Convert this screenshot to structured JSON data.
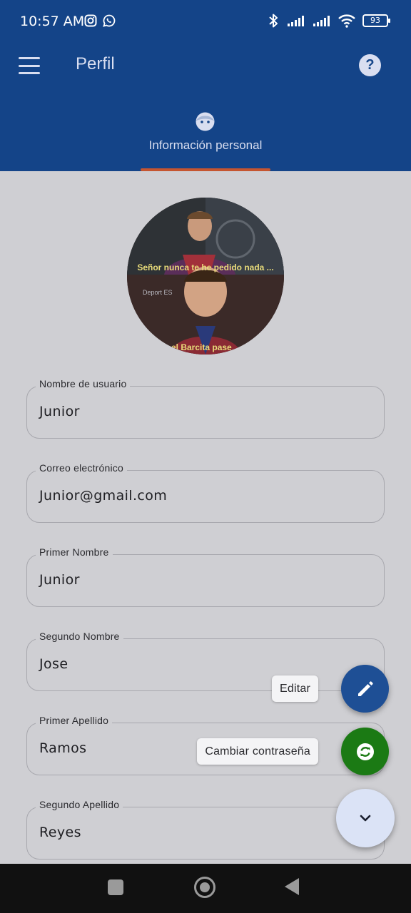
{
  "status_bar": {
    "time": "10:57 AM",
    "battery": "93",
    "icons": [
      "instagram-icon",
      "whatsapp-icon",
      "bluetooth-icon",
      "signal-icon",
      "signal-icon",
      "wifi-icon",
      "battery-icon"
    ]
  },
  "app_bar": {
    "title": "Perfil",
    "menu_icon": "menu-icon",
    "help_icon": "help-icon",
    "help_glyph": "?"
  },
  "tabs": [
    {
      "label": "Información personal",
      "icon": "face-icon",
      "selected": true
    }
  ],
  "avatar": {
    "caption_top": "Señor nunca te he pedido nada ...",
    "caption_bottom": "el Barcita pase",
    "watermark": "Deport ES"
  },
  "fields": [
    {
      "label": "Nombre de usuario",
      "value": "Junior"
    },
    {
      "label": "Correo electrónico",
      "value": "Junior@gmail.com"
    },
    {
      "label": "Primer Nombre",
      "value": "Junior"
    },
    {
      "label": "Segundo Nombre",
      "value": "Jose"
    },
    {
      "label": "Primer Apellido",
      "value": "Ramos"
    },
    {
      "label": "Segundo Apellido",
      "value": "Reyes"
    }
  ],
  "fab_menu": {
    "edit_label": "Editar",
    "password_label": "Cambiar contraseña",
    "edit_icon": "pencil-icon",
    "password_icon": "refresh-icon",
    "toggle_icon": "chevron-down-icon"
  },
  "colors": {
    "app_bar": "#144488",
    "tab_indicator": "#c55530",
    "fab_edit": "#1e4f95",
    "fab_password": "#1b7a14",
    "fab_toggle": "#dbe3f6"
  }
}
